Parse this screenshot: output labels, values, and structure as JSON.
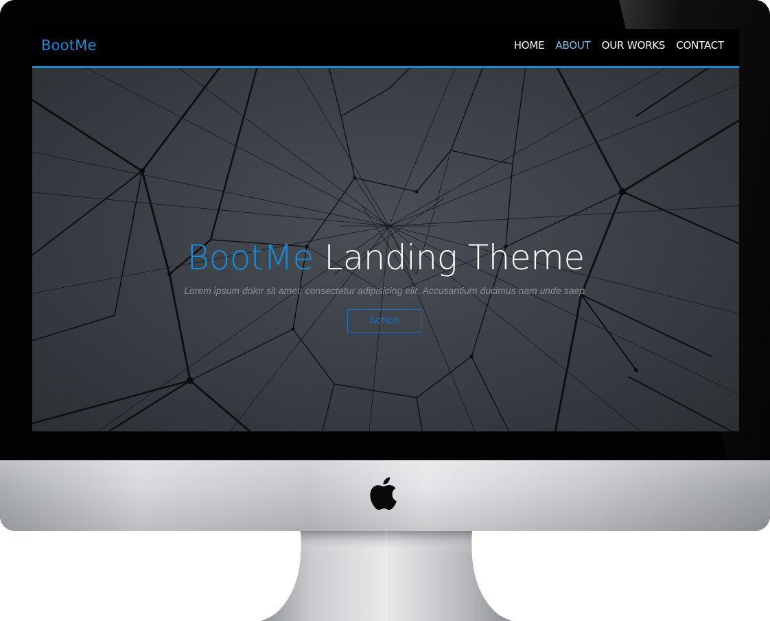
{
  "brand": "BootMe",
  "nav": {
    "items": [
      {
        "label": "HOME"
      },
      {
        "label": "ABOUT"
      },
      {
        "label": "OUR WORKS"
      },
      {
        "label": "CONTACT"
      }
    ],
    "active_index": 1
  },
  "hero": {
    "title_accent": "BootMe",
    "title_rest": " Landing Theme",
    "subtitle": "Lorem ipsum dolor sit amet, consectetur adipisicing elit. Accusantium ducimus nam unde saep.",
    "button_label": "Action"
  },
  "colors": {
    "accent": "#1a8ad4",
    "nav_active": "#7fc3ee",
    "button": "#1a6fd0",
    "hero_bg": "#3c4148"
  },
  "icons": {
    "device_logo": "apple-logo-icon"
  }
}
